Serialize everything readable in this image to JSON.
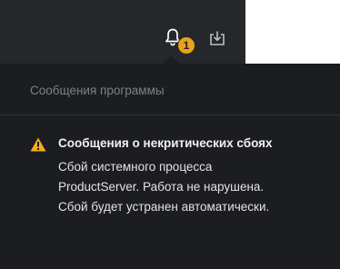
{
  "toolbar": {
    "notification_count": "1",
    "accent_color": "#e8a31c"
  },
  "panel": {
    "title": "Сообщения программы",
    "notice": {
      "icon": "warning-triangle-icon",
      "title": "Сообщения о некритических сбоях",
      "body_lines": [
        "Сбой системного процесса",
        "ProductServer. Работа не нарушена.",
        "Сбой будет устранен автоматически."
      ]
    }
  }
}
